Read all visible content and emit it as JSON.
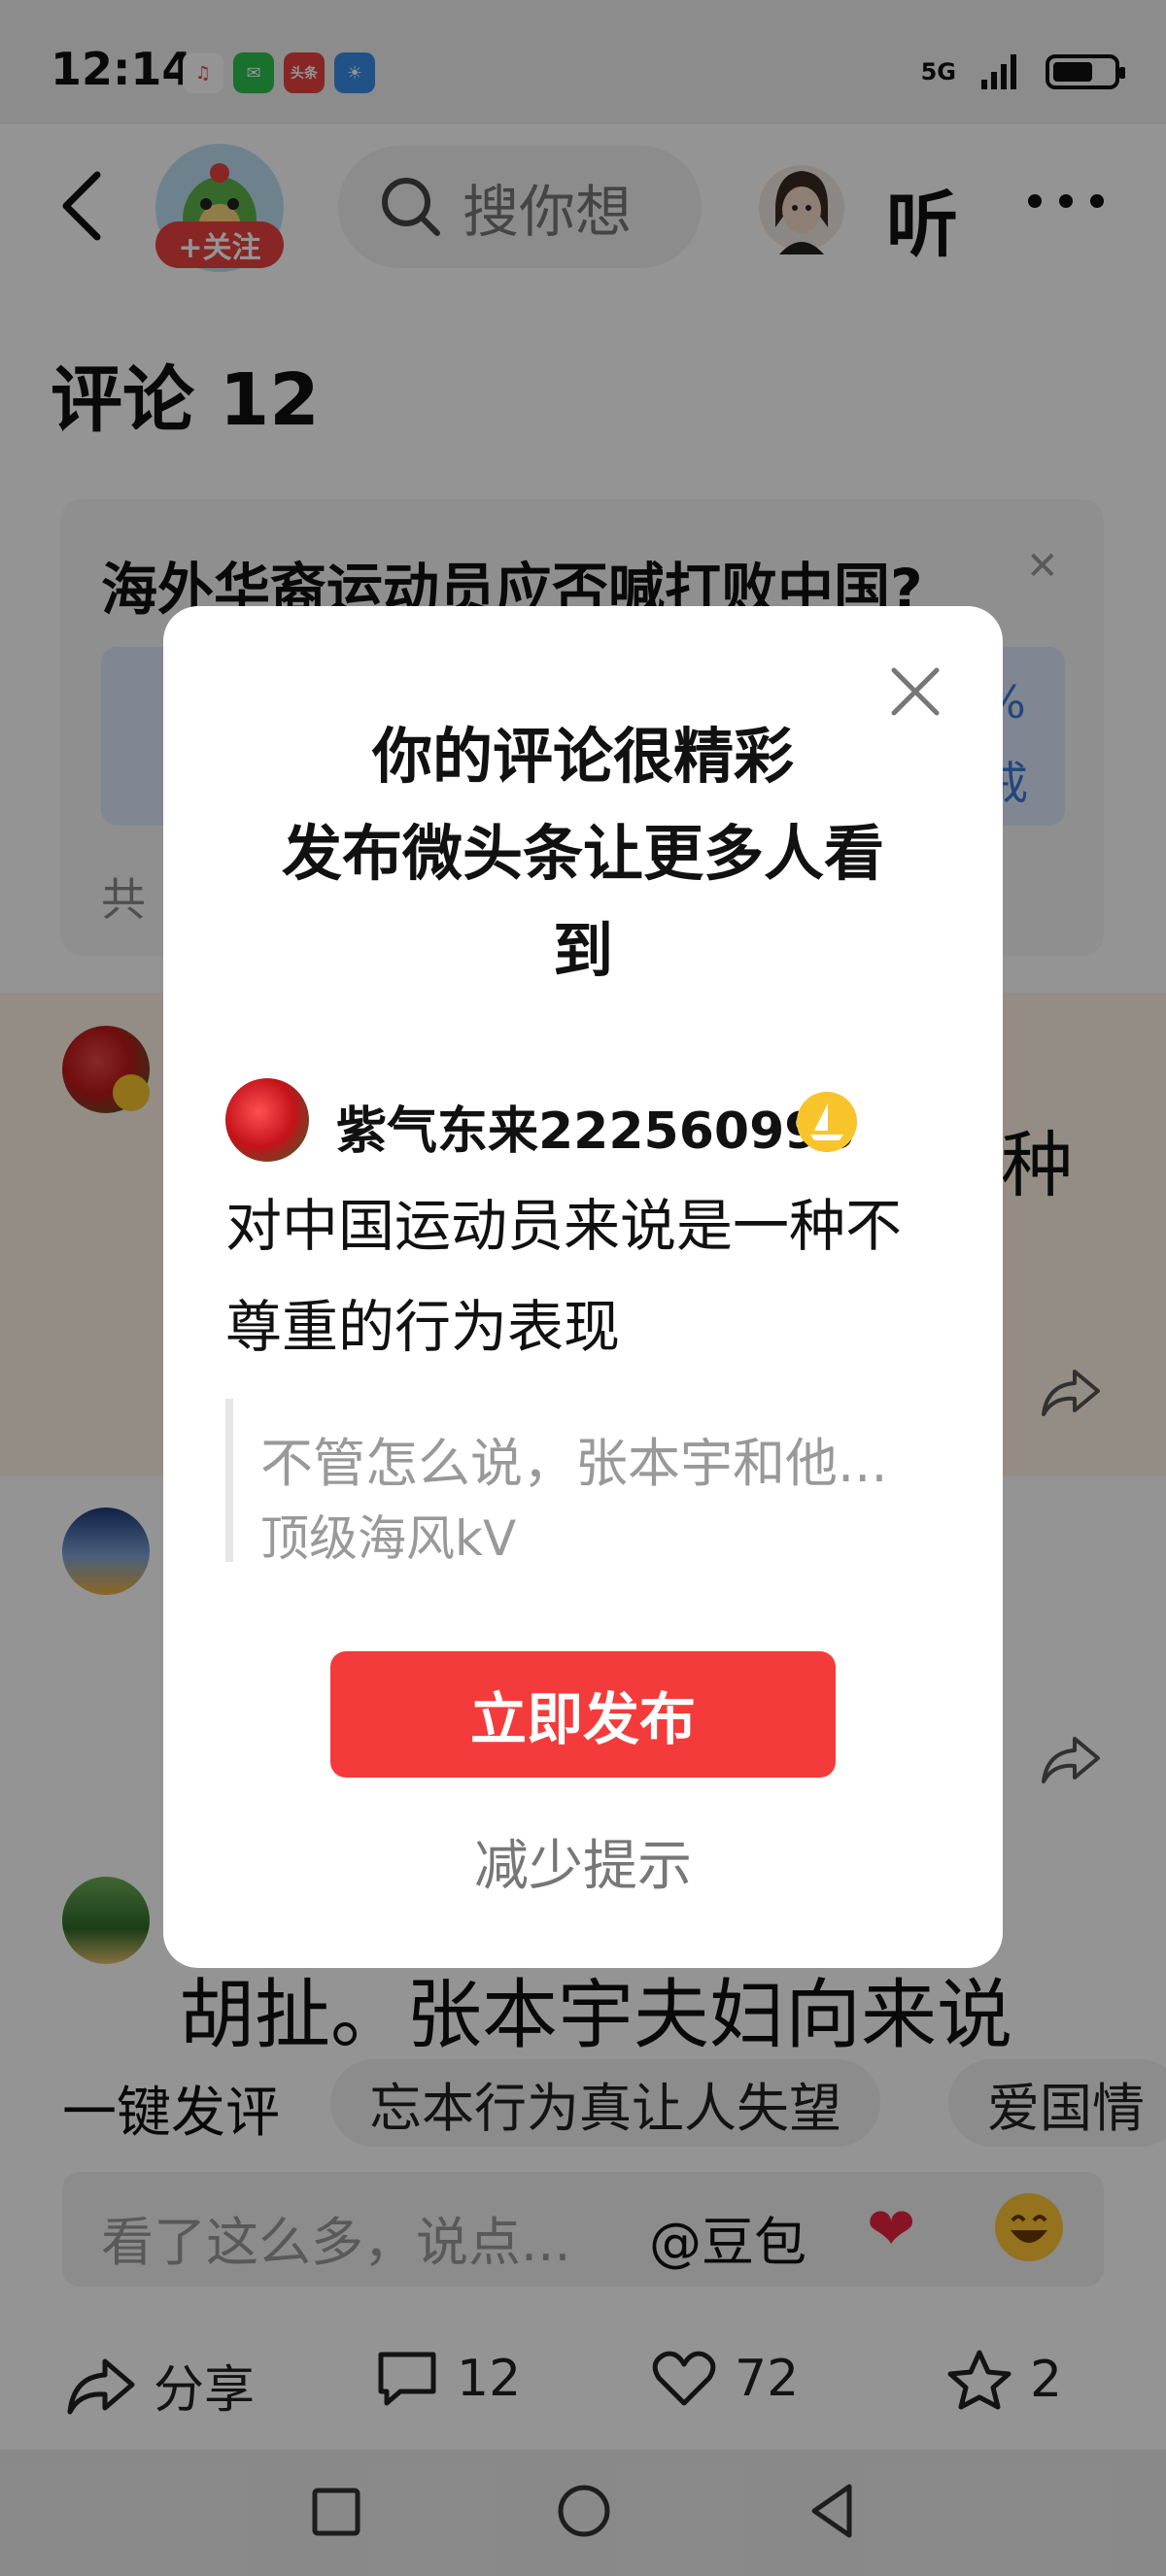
{
  "status_bar": {
    "time": "12:14",
    "app_icons": [
      {
        "name": "music-app-icon",
        "color": "#ffffff",
        "label": "♫"
      },
      {
        "name": "wechat-icon",
        "color": "#2dc24f",
        "label": "✉"
      },
      {
        "name": "toutiao-icon",
        "color": "#e8423e",
        "label": "头条"
      },
      {
        "name": "weather-icon",
        "color": "#3a8ee8",
        "label": "☀"
      }
    ],
    "network": "5G",
    "battery_percent": 60
  },
  "header": {
    "follow_label": "+关注",
    "search_placeholder": "搜你想",
    "listen_label": "听"
  },
  "comments_header": {
    "title": "评论 12"
  },
  "poll": {
    "question": "海外华裔运动员应否喊打败中国?",
    "option_percent": "%",
    "option_suffix": "戒",
    "total_prefix": "共"
  },
  "comments": {
    "c1_fragment": "种",
    "c3_text": "胡扯。张本宇夫妇向来说"
  },
  "quick_comment": {
    "label": "一键发评",
    "tags": [
      "忘本行为真让人失望",
      "爱国情"
    ]
  },
  "input_bar": {
    "placeholder": "看了这么多，说点...",
    "doubao_label": "@豆包",
    "heart_emoji": "❤",
    "laugh_emoji": "😄"
  },
  "actions": {
    "share_label": "分享",
    "comment_count": "12",
    "like_count": "72",
    "favorite_count": "2"
  },
  "dialog": {
    "title_line1": "你的评论很精彩",
    "title_line2": "发布微头条让更多人看",
    "title_line3": "到",
    "username": "紫气东来222560996",
    "comment_line1": "对中国运动员来说是一种不",
    "comment_line2": "尊重的行为表现",
    "quote_text": "不管怎么说，张本宇和他...",
    "quote_author": "顶级海风kV",
    "publish_label": "立即发布",
    "reduce_label": "减少提示"
  }
}
